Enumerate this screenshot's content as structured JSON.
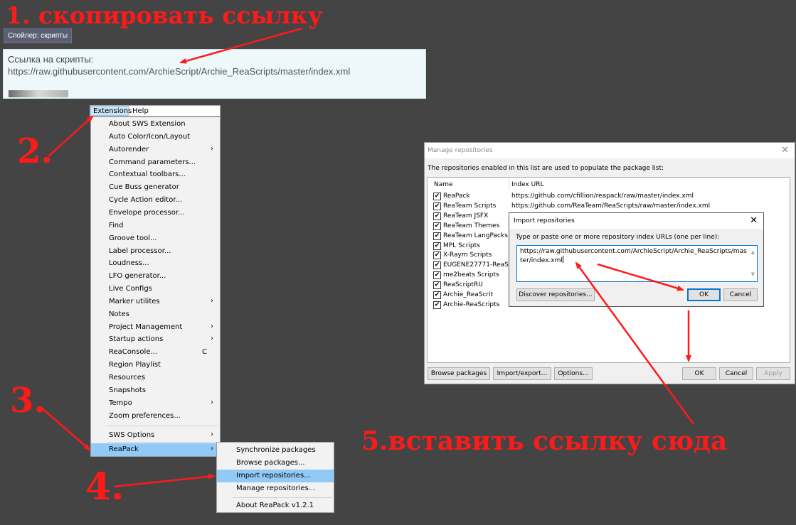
{
  "steps": {
    "s1": "1. скопировать ссылку",
    "s2": "2.",
    "s3": "3.",
    "s4": "4.",
    "s5": "5.вставить ссылку сюда"
  },
  "forum": {
    "spoiler_label": "Спойлер: скрипты",
    "link_label": "Ссылка на скрипты:",
    "link_url": "https://raw.githubusercontent.com/ArchieScript/Archie_ReaScripts/master/index.xml"
  },
  "menubar": {
    "extensions": "Extensions",
    "help": "Help"
  },
  "ext_menu": [
    {
      "label": "About SWS Extension",
      "arrow": false
    },
    {
      "label": "Auto Color/Icon/Layout",
      "arrow": false
    },
    {
      "label": "Autorender",
      "arrow": true
    },
    {
      "label": "Command parameters...",
      "arrow": false
    },
    {
      "label": "Contextual toolbars...",
      "arrow": false
    },
    {
      "label": "Cue Buss generator",
      "arrow": false
    },
    {
      "label": "Cycle Action editor...",
      "arrow": false
    },
    {
      "label": "Envelope processor...",
      "arrow": false
    },
    {
      "label": "Find",
      "arrow": false
    },
    {
      "label": "Groove tool...",
      "arrow": false
    },
    {
      "label": "Label processor...",
      "arrow": false
    },
    {
      "label": "Loudness...",
      "arrow": false
    },
    {
      "label": "LFO generator...",
      "arrow": false
    },
    {
      "label": "Live Configs",
      "arrow": false
    },
    {
      "label": "Marker utilites",
      "arrow": true
    },
    {
      "label": "Notes",
      "arrow": false
    },
    {
      "label": "Project Management",
      "arrow": true
    },
    {
      "label": "Startup actions",
      "arrow": true
    },
    {
      "label": "ReaConsole...",
      "arrow": false,
      "key": "C"
    },
    {
      "label": "Region Playlist",
      "arrow": false
    },
    {
      "label": "Resources",
      "arrow": false
    },
    {
      "label": "Snapshots",
      "arrow": false
    },
    {
      "label": "Tempo",
      "arrow": true
    },
    {
      "label": "Zoom preferences...",
      "arrow": false
    }
  ],
  "sws_options": "SWS Options",
  "reapack": "ReaPack",
  "arrow_glyph": "›",
  "reapack_menu": {
    "sync": "Synchronize packages",
    "browse": "Browse packages...",
    "import": "Import repositories...",
    "manage": "Manage repositories...",
    "about": "About ReaPack v1.2.1"
  },
  "manage_dialog": {
    "title": "Manage repositories",
    "description": "The repositories enabled in this list are used to populate the package list:",
    "col_name": "Name",
    "col_url": "Index URL",
    "repos": [
      {
        "name": "ReaPack",
        "url": "https://github.com/cfillion/reapack/raw/master/index.xml"
      },
      {
        "name": "ReaTeam Scripts",
        "url": "https://github.com/ReaTeam/ReaScripts/raw/master/index.xml"
      },
      {
        "name": "ReaTeam JSFX",
        "url": ""
      },
      {
        "name": "ReaTeam Themes",
        "url": ""
      },
      {
        "name": "ReaTeam LangPacks",
        "url": ""
      },
      {
        "name": "MPL Scripts",
        "url": ""
      },
      {
        "name": "X-Raym Scripts",
        "url": ""
      },
      {
        "name": "EUGENE27771-ReaS...",
        "url": ""
      },
      {
        "name": "me2beats Scripts",
        "url": ""
      },
      {
        "name": "ReaScriptRU",
        "url": ""
      },
      {
        "name": "Archie_ReaScrit",
        "url": ""
      },
      {
        "name": "Archie-ReaScripts",
        "url": ""
      }
    ],
    "browse_btn": "Browse packages",
    "import_export_btn": "Import/export...",
    "options_btn": "Options...",
    "ok_btn": "OK",
    "cancel_btn": "Cancel",
    "apply_btn": "Apply"
  },
  "import_dialog": {
    "title": "Import repositories",
    "instruction": "Type or paste one or more repository index URLs (one per line):",
    "text_value": "https://raw.githubusercontent.com/ArchieScript/Archie_ReaScripts/master/index.xml",
    "discover_btn": "Discover repositories...",
    "ok_btn": "OK",
    "cancel_btn": "Cancel"
  },
  "colors": {
    "background": "#444444",
    "annotation": "#ff1a1a",
    "highlight": "#91c9f7"
  }
}
